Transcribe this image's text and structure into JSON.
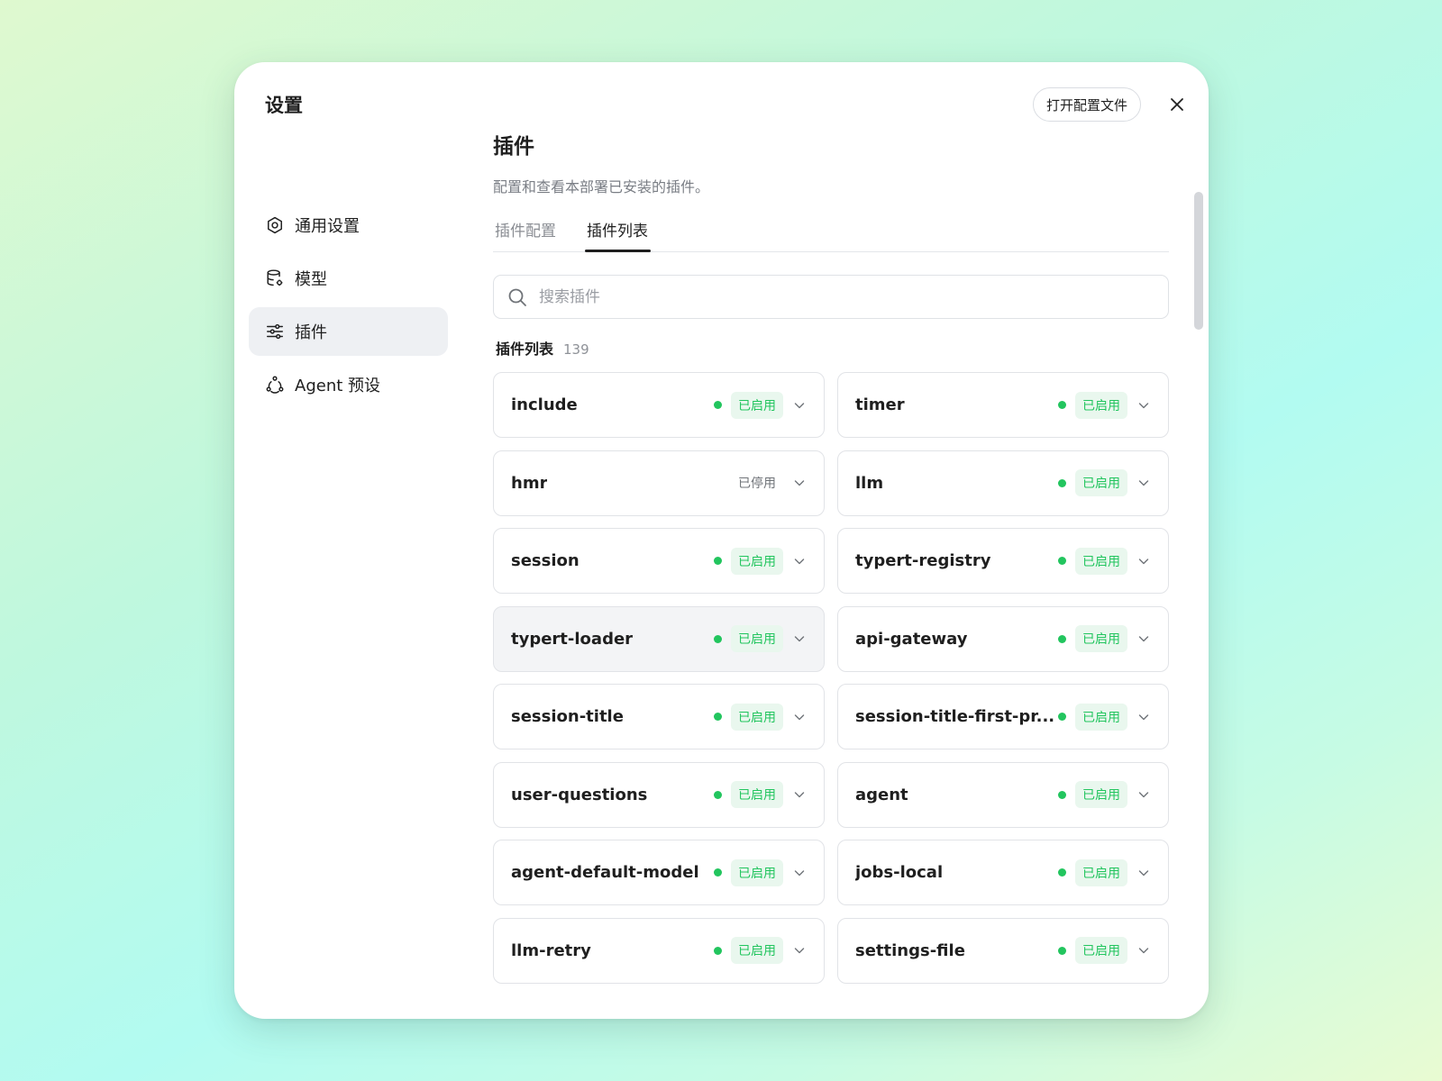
{
  "sidebar": {
    "title": "设置",
    "items": [
      {
        "label": "通用设置",
        "icon": "gear-icon"
      },
      {
        "label": "模型",
        "icon": "database-icon"
      },
      {
        "label": "插件",
        "icon": "sliders-icon",
        "active": true
      },
      {
        "label": "Agent 预设",
        "icon": "agent-icon"
      }
    ]
  },
  "header": {
    "open_config_label": "打开配置文件"
  },
  "main": {
    "title": "插件",
    "description": "配置和查看本部署已安装的插件。",
    "tabs": [
      {
        "label": "插件配置",
        "active": false
      },
      {
        "label": "插件列表",
        "active": true
      }
    ],
    "search": {
      "placeholder": "搜索插件",
      "value": ""
    },
    "list_label": "插件列表",
    "list_count": "139",
    "plugins": [
      {
        "name": "include",
        "status": "已启用",
        "enabled": true
      },
      {
        "name": "timer",
        "status": "已启用",
        "enabled": true
      },
      {
        "name": "hmr",
        "status": "已停用",
        "enabled": false
      },
      {
        "name": "llm",
        "status": "已启用",
        "enabled": true
      },
      {
        "name": "session",
        "status": "已启用",
        "enabled": true
      },
      {
        "name": "typert-registry",
        "status": "已启用",
        "enabled": true
      },
      {
        "name": "typert-loader",
        "status": "已启用",
        "enabled": true,
        "hover": true
      },
      {
        "name": "api-gateway",
        "status": "已启用",
        "enabled": true
      },
      {
        "name": "session-title",
        "status": "已启用",
        "enabled": true
      },
      {
        "name": "session-title-first-pr...",
        "status": "已启用",
        "enabled": true
      },
      {
        "name": "user-questions",
        "status": "已启用",
        "enabled": true
      },
      {
        "name": "agent",
        "status": "已启用",
        "enabled": true
      },
      {
        "name": "agent-default-model",
        "status": "已启用",
        "enabled": true
      },
      {
        "name": "jobs-local",
        "status": "已启用",
        "enabled": true
      },
      {
        "name": "llm-retry",
        "status": "已启用",
        "enabled": true
      },
      {
        "name": "settings-file",
        "status": "已启用",
        "enabled": true
      }
    ]
  },
  "colors": {
    "enabled_green": "#22c55e",
    "badge_bg": "#e9f7ee",
    "active_nav_bg": "#eef0f3"
  }
}
